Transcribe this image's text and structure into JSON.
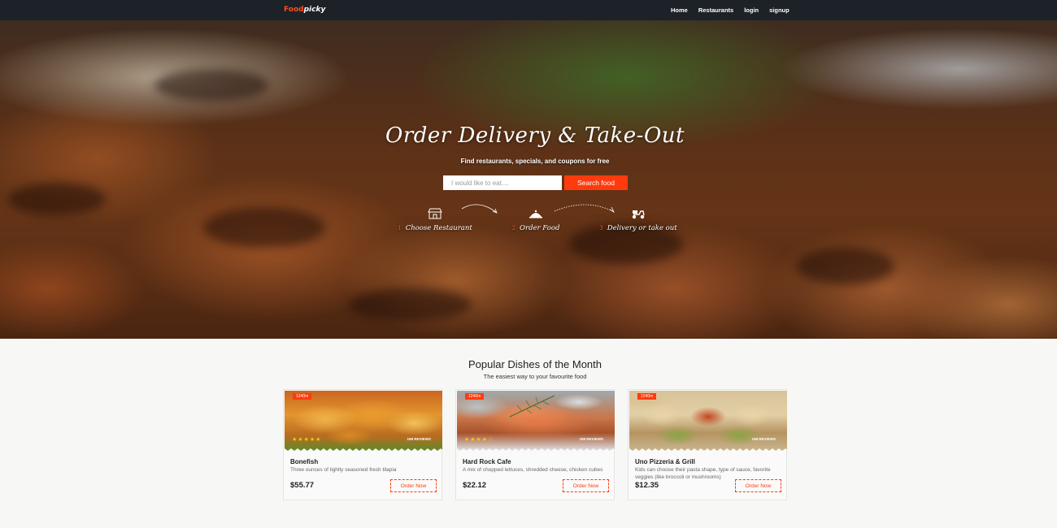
{
  "header": {
    "logo": {
      "part1": "Food",
      "part2": "picky"
    },
    "nav": [
      "Home",
      "Restaurants",
      "login",
      "signup"
    ]
  },
  "hero": {
    "title": "Order Delivery & Take-Out",
    "subtitle": "Find restaurants, specials, and coupons for free",
    "search": {
      "placeholder": "I would like to eat....",
      "button": "Search food"
    },
    "steps": [
      {
        "num": "1",
        "label": "Choose Restaurant",
        "icon": "store-icon"
      },
      {
        "num": "2",
        "label": "Order Food",
        "icon": "cloche-icon"
      },
      {
        "num": "3",
        "label": "Delivery or take out",
        "icon": "scooter-icon"
      }
    ]
  },
  "popular": {
    "title": "Popular Dishes of the Month",
    "subtitle": "The easiest way to your favourite food",
    "cards": [
      {
        "badge": "1240m",
        "reviews": "198 REVIEWS",
        "name": "Bonefish",
        "desc": "Three ounces of lightly seasoned fresh tilapia",
        "price": "$55.77",
        "order": "Order Now"
      },
      {
        "badge": "1240m",
        "reviews": "198 REVIEWS",
        "name": "Hard Rock Cafe",
        "desc": "A mix of chopped lettuces, shredded cheese, chicken cubes",
        "price": "$22.12",
        "order": "Order Now"
      },
      {
        "badge": "1240m",
        "reviews": "198 REVIEWS",
        "name": "Uno Pizzeria & Grill",
        "desc": "Kids can choose their pasta shape, type of sauce, favorite veggies (like broccoli or mushrooms)",
        "price": "$12.35",
        "order": "Order Now"
      }
    ]
  },
  "colors": {
    "accent": "#ff3b0e",
    "navbar": "#1d2228",
    "star": "#f5c518"
  }
}
